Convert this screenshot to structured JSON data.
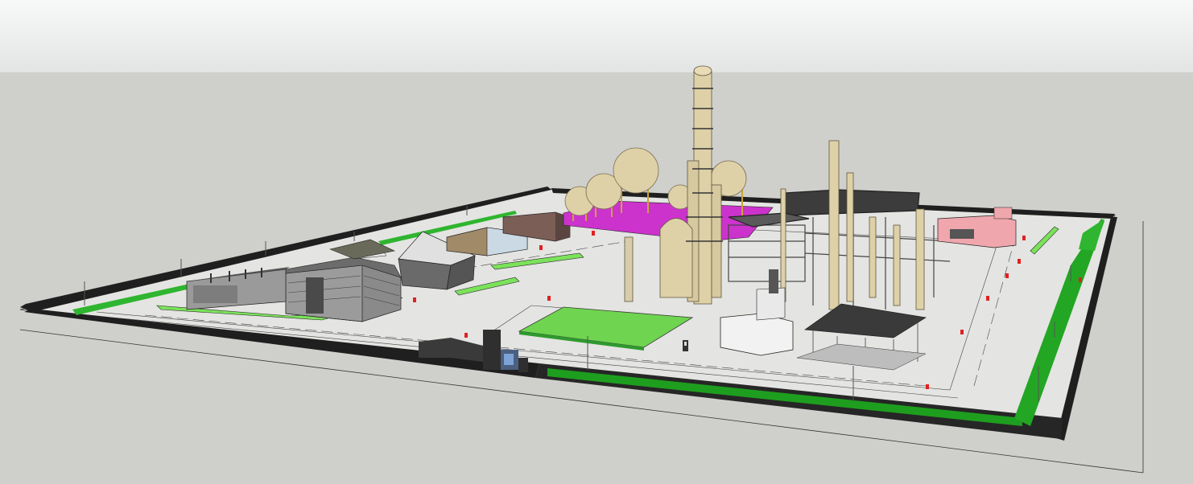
{
  "colors": {
    "sky": "#eceeee",
    "ground": "#cfd0cc",
    "plot": "#e6e6e6",
    "grass": "#2fb52f",
    "grass_light": "#7be25a",
    "fence": "#2a2a2a",
    "tank": "#ded1a8",
    "tank_shadow": "#b9ab82",
    "magenta": "#cc33cc",
    "pink_building": "#f0a6ad",
    "steel": "#555555",
    "office": "#9a9a9a",
    "roof": "#5a5a5a",
    "hydrant": "#dd2222"
  },
  "scene": {
    "icons": [
      "fire-hydrant-icon",
      "street-lamp-icon",
      "warning-sign-icon"
    ]
  }
}
